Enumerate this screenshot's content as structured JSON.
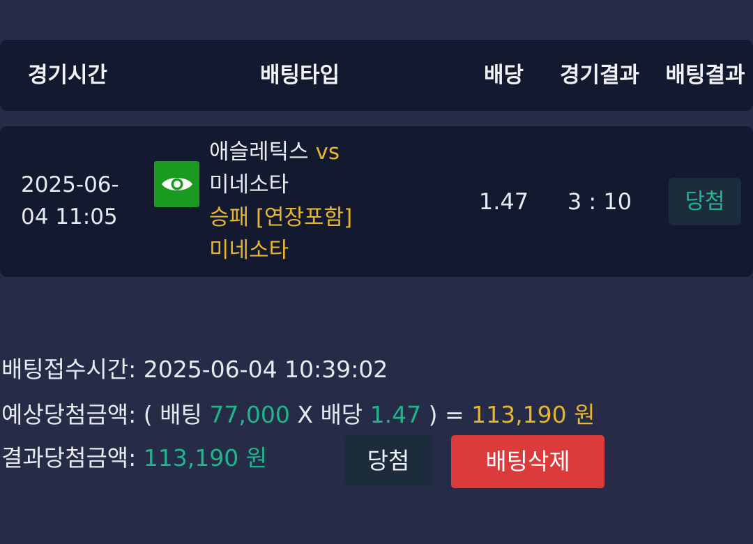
{
  "table": {
    "headers": {
      "game_time": "경기시간",
      "bet_type": "배팅타입",
      "odds": "배당",
      "game_result": "경기결과",
      "bet_result": "배팅결과"
    },
    "row": {
      "game_time": "2025-06-04 11:05",
      "home_team": "애슬레틱스",
      "vs": "vs",
      "away_team": "미네소타",
      "market": "승패 [연장포함]",
      "pick": "미네소타",
      "odds": "1.47",
      "score": "3 : 10",
      "result": "당첨",
      "view_icon": "eye-icon"
    }
  },
  "summary": {
    "received_label": "배팅접수시간:",
    "received_value": "2025-06-04 10:39:02",
    "expected_label": "예상당첨금액:",
    "expected_open": "( 배팅",
    "stake": "77,000",
    "times_odds": "X 배당",
    "odds": "1.47",
    "expected_close": ") =",
    "expected_amount": "113,190 원",
    "result_label": "결과당첨금액:",
    "result_amount": "113,190 원"
  },
  "buttons": {
    "win": "당첨",
    "delete": "배팅삭제"
  },
  "colors": {
    "background": "#262c47",
    "panel": "#131a30",
    "accent_green": "#1fb68a",
    "accent_yellow": "#e8b62a",
    "danger": "#dc3b3c",
    "view_icon_bg": "#1a9a1f"
  }
}
